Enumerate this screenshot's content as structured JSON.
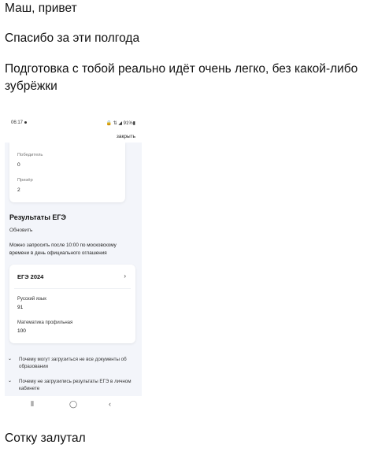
{
  "messages": {
    "m1": "Маш, привет",
    "m2": "Спасибо за эти полгода",
    "m3": "Подготовка с тобой реально идёт очень легко, без какой-либо зубрёжки",
    "m4": "Сотку залутал"
  },
  "phone": {
    "status": {
      "time": "06:17",
      "right": "🔒 ⇅ ◢ 91%▮"
    },
    "close": "закрыть",
    "olympiad": {
      "winner_label": "Победитель",
      "winner_value": "0",
      "prize_label": "Призёр",
      "prize_value": "2"
    },
    "ege": {
      "section_title": "Результаты ЕГЭ",
      "refresh": "Обновить",
      "note": "Можно запросить после 10:00 по московскому времени в день официального оглашения",
      "card_title": "ЕГЭ 2024",
      "chevron": "›",
      "subjects": [
        {
          "name": "Русский язык",
          "score": "91"
        },
        {
          "name": "Математика профильная",
          "score": "100"
        }
      ]
    },
    "faq": [
      {
        "chevron": "⌄",
        "text": "Почему могут загрузиться не все документы об образовании"
      },
      {
        "chevron": "⌄",
        "text": "Почему не загрузились результаты ЕГЭ в личном кабинете"
      }
    ],
    "nav": {
      "recent": "⦀",
      "home": "◯",
      "back": "‹"
    }
  }
}
